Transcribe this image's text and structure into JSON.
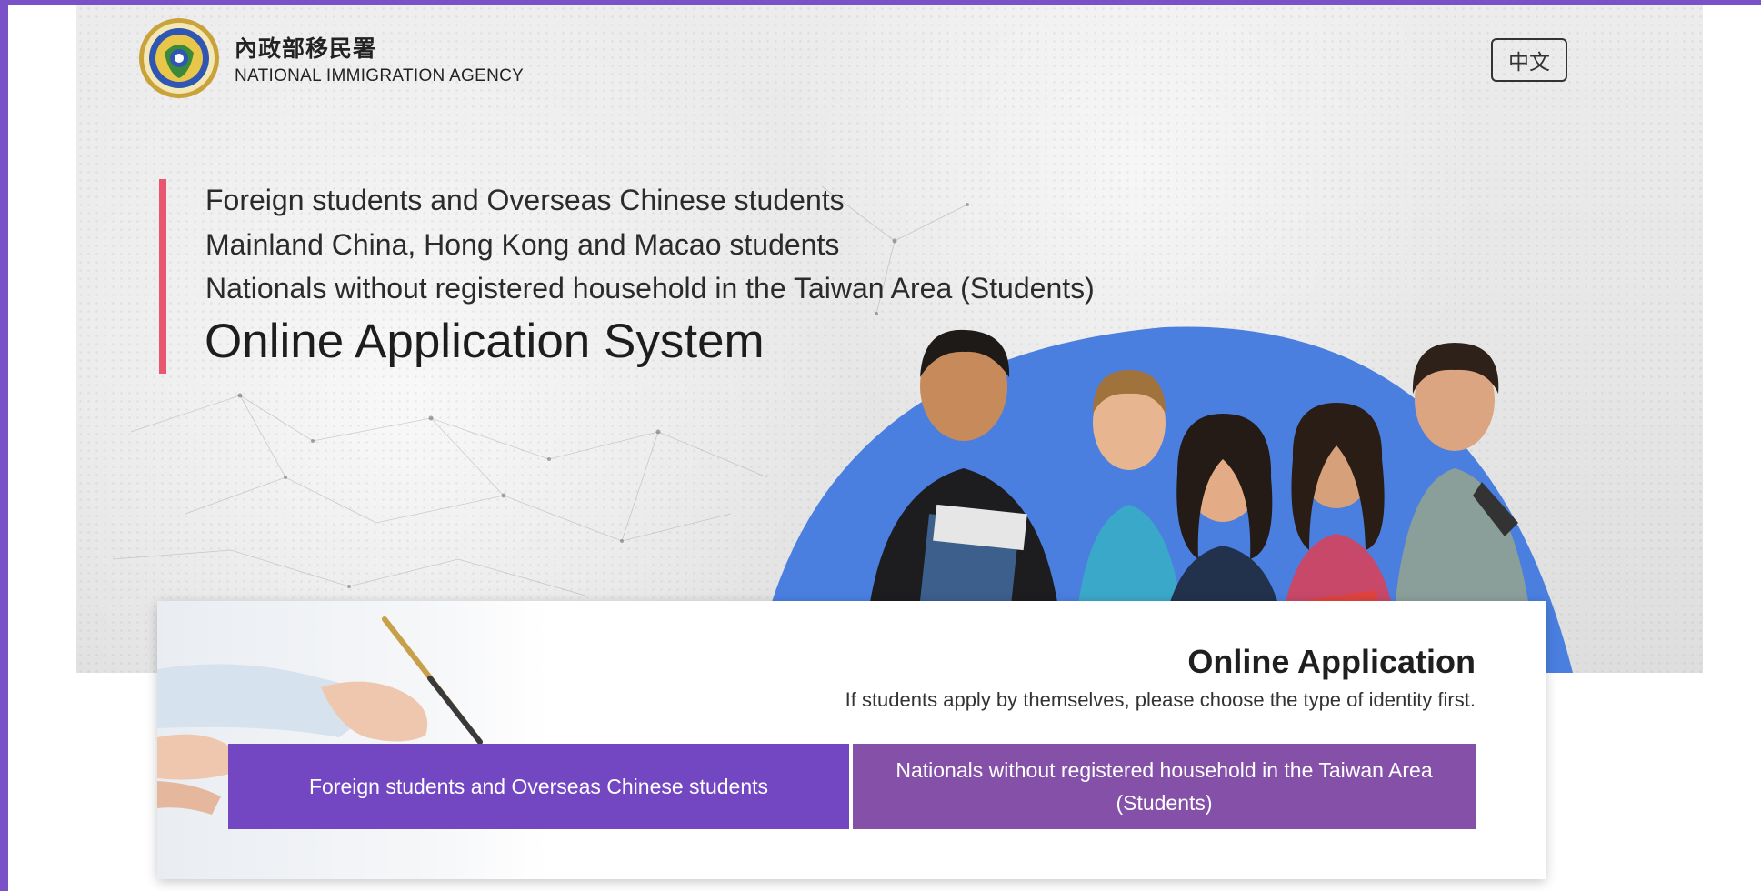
{
  "header": {
    "agency_name_zh": "內政部移民署",
    "agency_name_en": "NATIONAL IMMIGRATION AGENCY",
    "logo_icon": "agency-seal-icon",
    "language_toggle": "中文"
  },
  "hero": {
    "lines": [
      "Foreign students and Overseas Chinese students",
      "Mainland China, Hong Kong and Macao students",
      "Nationals without registered household in the Taiwan Area (Students)"
    ],
    "title": "Online Application System"
  },
  "application": {
    "title": "Online Application",
    "subtitle": "If students apply by themselves, please choose the type of identity first.",
    "options": [
      "Foreign students and Overseas Chinese students",
      "Nationals without registered household in the Taiwan Area (Students)"
    ]
  },
  "colors": {
    "frame": "#7952c7",
    "accent_bar": "#e8576f",
    "button_primary": "#7447c2",
    "button_secondary": "#8550a8",
    "hero_circle": "#4a7fe0"
  }
}
